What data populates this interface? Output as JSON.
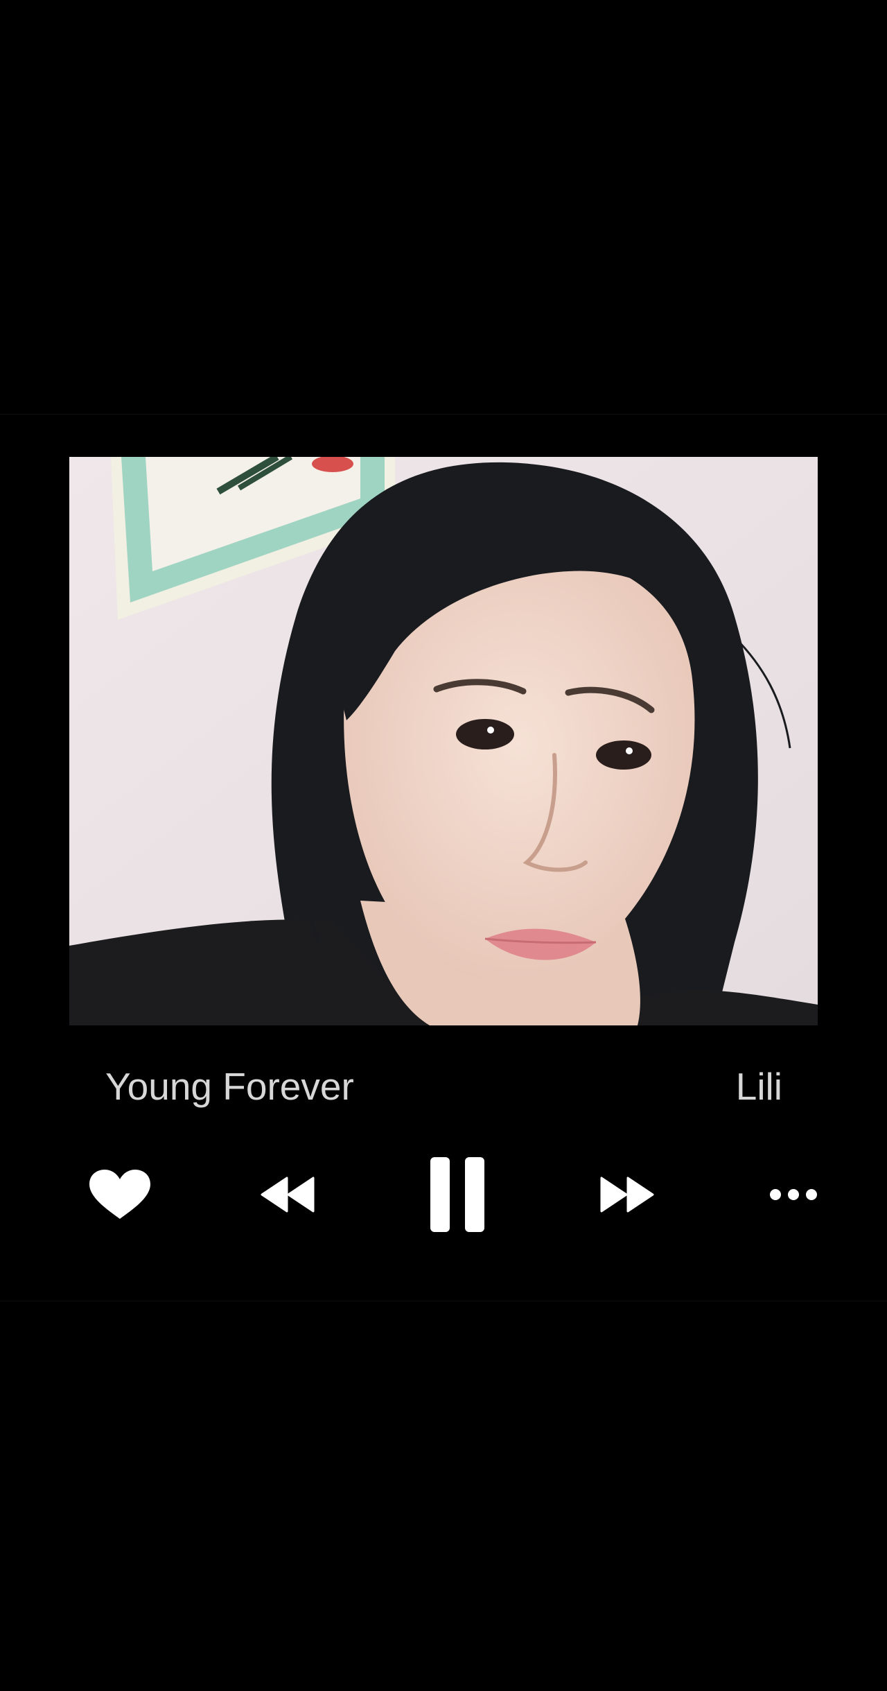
{
  "track": {
    "title": "Young Forever",
    "artist": "Lili"
  },
  "album_art": {
    "description_icon": "album-cover-photo"
  },
  "controls": {
    "like_icon": "heart-icon",
    "previous_icon": "rewind-icon",
    "play_state_icon": "pause-icon",
    "next_icon": "fast-forward-icon",
    "more_icon": "more-options-icon"
  },
  "colors": {
    "background": "#000000",
    "text": "#d7d7d7",
    "icon": "#ffffff"
  }
}
